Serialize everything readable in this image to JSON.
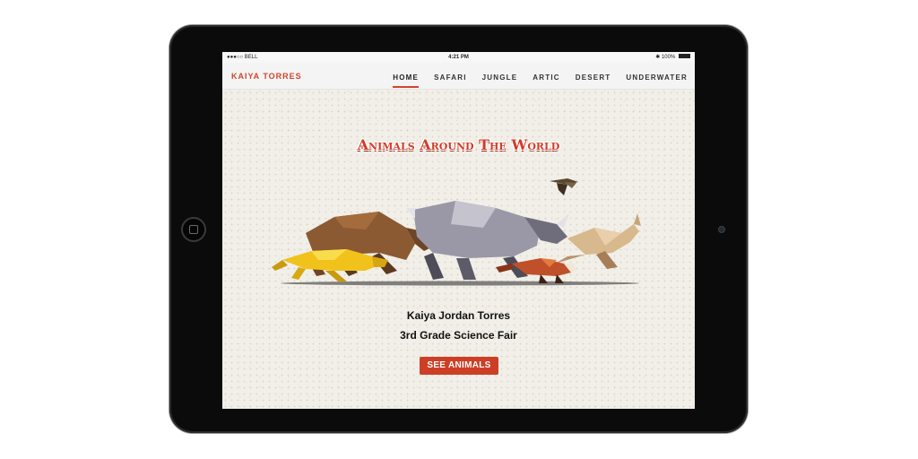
{
  "status_bar": {
    "carrier": "●●●○○ BELL",
    "time": "4:21 PM",
    "battery": "100%",
    "bluetooth_icon": "bluetooth-icon",
    "wifi_icon": "wifi-icon",
    "battery_icon": "battery-icon"
  },
  "nav": {
    "brand": "KAIYA TORRES",
    "links": [
      "HOME",
      "SAFARI",
      "JUNGLE",
      "ARTIC",
      "DESERT",
      "UNDERWATER"
    ],
    "active": "HOME"
  },
  "hero": {
    "title": "Animals Around The World",
    "illustration": "polygonal-animals-running-illustration"
  },
  "credits": {
    "name": "Kaiya Jordan Torres",
    "subtitle": "3rd Grade Science Fair"
  },
  "cta": {
    "label": "SEE ANIMALS"
  },
  "colors": {
    "accent": "#d2452b",
    "tablet": "#0b0b0b",
    "background": "#f1efe8"
  }
}
